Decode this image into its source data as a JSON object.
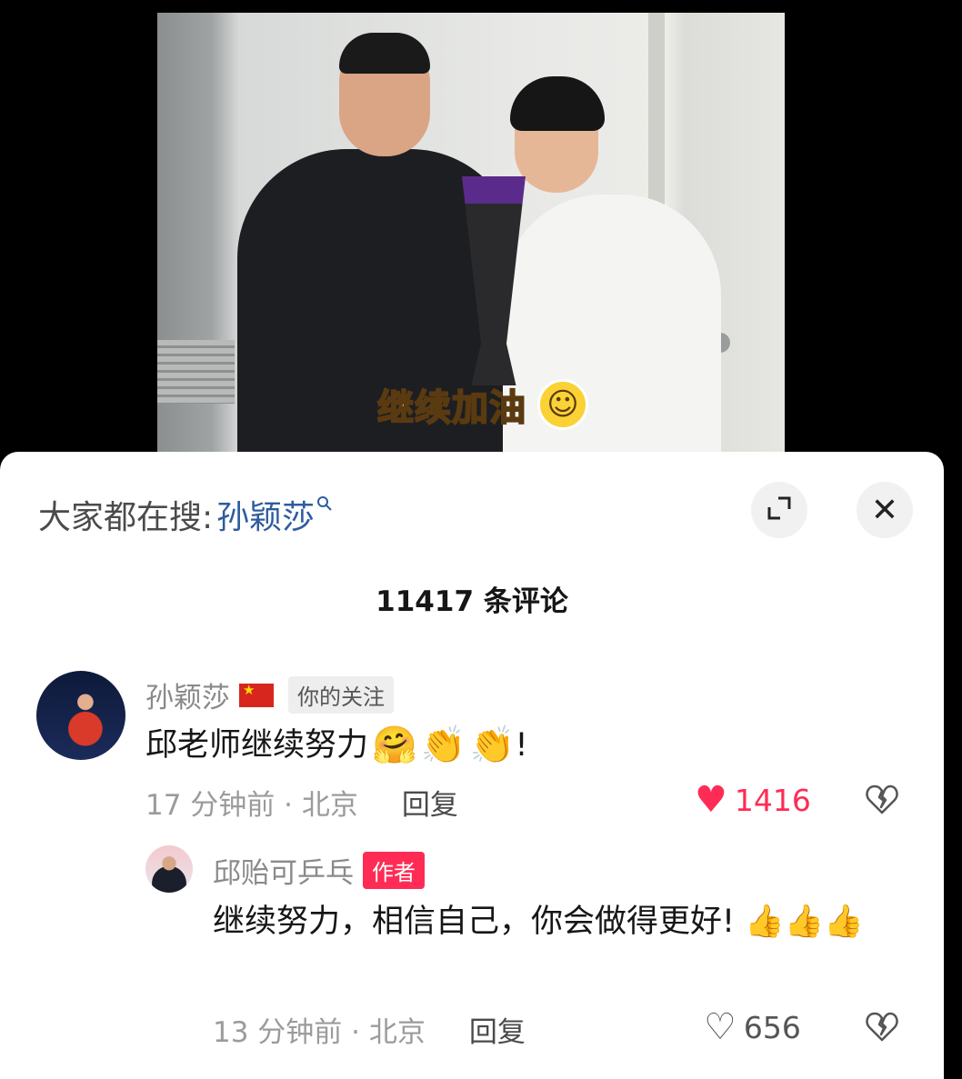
{
  "video": {
    "caption": "继续加油",
    "caption_emoji": "☺"
  },
  "header": {
    "search_prefix": "大家都在搜:",
    "search_keyword": "孙颖莎",
    "expand_icon": "expand-icon",
    "close_label": "✕"
  },
  "comments_count": "11417 条评论",
  "comments": [
    {
      "author": "孙颖莎",
      "flag": "china-flag",
      "tag": "你的关注",
      "text": "邱老师继续努力",
      "emojis": [
        "🤗",
        "👏",
        "👏"
      ],
      "text_end": "!",
      "time_location": "17 分钟前 · 北京",
      "reply": "回复",
      "likes": "1416",
      "liked": true
    },
    {
      "author": "邱贻可乒乓",
      "tag": "作者",
      "text": "继续努力，相信自己，你会做得更好! 👍👍👍",
      "time_location": "13 分钟前 · 北京",
      "reply": "回复",
      "likes": "656",
      "liked": false
    }
  ],
  "icons": {
    "heart_full": "♥",
    "heart_empty": "♡",
    "dislike": "💔"
  }
}
